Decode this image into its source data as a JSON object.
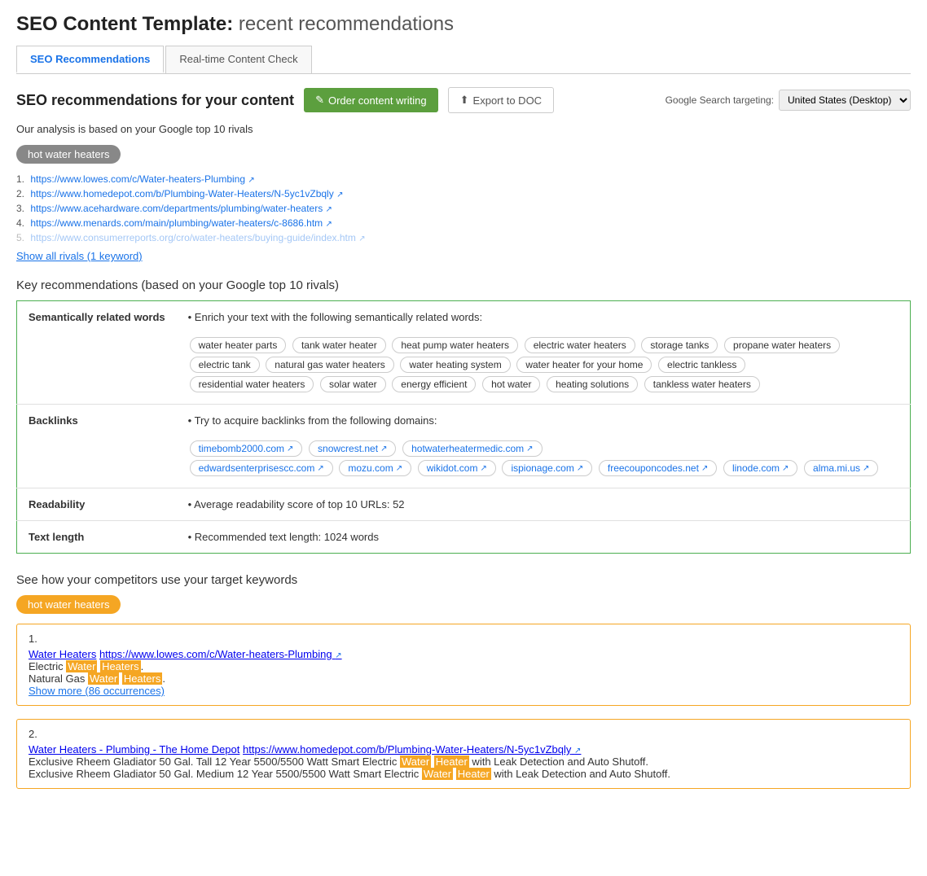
{
  "pageTitle": {
    "prefix": "SEO Content Template:",
    "suffix": "recent recommendations"
  },
  "tabs": [
    {
      "label": "SEO Recommendations",
      "active": true
    },
    {
      "label": "Real-time Content Check",
      "active": false
    }
  ],
  "header": {
    "title": "SEO recommendations for your content",
    "orderBtn": "Order content writing",
    "exportBtn": "Export to DOC",
    "googleTargetingLabel": "Google Search targeting:",
    "googleTargetingValue": "United States (Desktop)"
  },
  "analysisNote": "Our analysis is based on your Google top 10 rivals",
  "keywordBadge": "hot water heaters",
  "rivals": [
    {
      "num": "1.",
      "url": "https://www.lowes.com/c/Water-heaters-Plumbing",
      "faded": false
    },
    {
      "num": "2.",
      "url": "https://www.homedepot.com/b/Plumbing-Water-Heaters/N-5yc1vZbqly",
      "faded": false
    },
    {
      "num": "3.",
      "url": "https://www.acehardware.com/departments/plumbing/water-heaters",
      "faded": false
    },
    {
      "num": "4.",
      "url": "https://www.menards.com/main/plumbing/water-heaters/c-8686.htm",
      "faded": false
    },
    {
      "num": "5.",
      "url": "https://www.consumerreports.org/cro/water-heaters/buying-guide/index.htm",
      "faded": true
    }
  ],
  "showAllRivals": "Show all rivals (1 keyword)",
  "keyRecommendationsTitle": "Key recommendations (based on your Google top 10 rivals)",
  "recommendationsTable": {
    "rows": [
      {
        "label": "Semantically related words",
        "bulletText": "Enrich your text with the following semantically related words:",
        "tags": [
          "water heater parts",
          "tank water heater",
          "heat pump water heaters",
          "electric water heaters",
          "storage tanks",
          "propane water heaters",
          "electric tank",
          "natural gas water heaters",
          "water heating system",
          "water heater for your home",
          "electric tankless",
          "residential water heaters",
          "solar water",
          "energy efficient",
          "hot water",
          "heating solutions",
          "tankless water heaters"
        ]
      },
      {
        "label": "Backlinks",
        "bulletText": "Try to acquire backlinks from the following domains:",
        "domains": [
          "timebomb2000.com",
          "snowcrest.net",
          "hotwaterheatermedic.com",
          "edwardsenterprisescc.com",
          "mozu.com",
          "wikidot.com",
          "ispionage.com",
          "freecouponcodes.net",
          "linode.com",
          "alma.mi.us"
        ]
      },
      {
        "label": "Readability",
        "bulletText": "Average readability score of top 10 URLs: 52"
      },
      {
        "label": "Text length",
        "bulletText": "Recommended text length: 1024 words"
      }
    ]
  },
  "competitorsSection": {
    "title": "See how your competitors use your target keywords",
    "keywordBadge": "hot water heaters",
    "items": [
      {
        "num": "1.",
        "title": "Water Heaters",
        "url": "https://www.lowes.com/c/Water-heaters-Plumbing",
        "snippets": [
          {
            "text": "Electric Water Heaters.",
            "highlight": [
              "Water",
              "Heaters"
            ]
          },
          {
            "text": "Natural Gas Water Heaters.",
            "highlight": [
              "Water",
              "Heaters"
            ]
          }
        ],
        "showMore": "Show more (86 occurrences)"
      },
      {
        "num": "2.",
        "title": "Water Heaters - Plumbing - The Home Depot",
        "url": "https://www.homedepot.com/b/Plumbing-Water-Heaters/N-5yc1vZbqly",
        "snippets": [
          {
            "text": "Exclusive Rheem Gladiator 50 Gal. Tall 12 Year 5500/5500 Watt Smart Electric Water Heater with Leak Detection and Auto Shutoff.",
            "highlight": [
              "Water",
              "Heater"
            ]
          },
          {
            "text": "Exclusive Rheem Gladiator 50 Gal. Medium 12 Year 5500/5500 Watt Smart Electric Water Heater with Leak Detection and Auto Shutoff.",
            "highlight": [
              "Water",
              "Heater"
            ]
          }
        ],
        "showMore": null
      }
    ]
  }
}
